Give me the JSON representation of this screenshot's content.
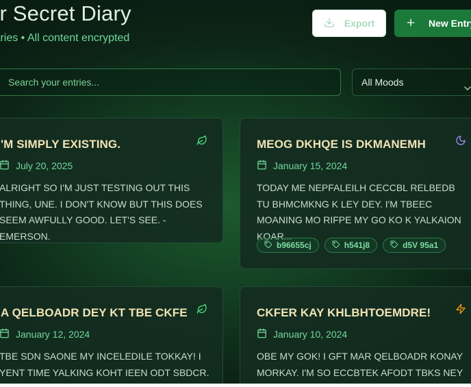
{
  "header": {
    "title": "ur Secret Diary",
    "subtitle": "tries • All content encrypted",
    "export_label": "Export",
    "new_entry_label": "New Entry"
  },
  "search": {
    "placeholder": "Search your entries..."
  },
  "mood_filter": {
    "selected": "All Moods"
  },
  "entries": [
    {
      "title": "'M SIMPLY EXISTING.",
      "date": "July 20, 2025",
      "mood_icon": "leaf-icon",
      "body": "ALRIGHT SO I'M JUST TESTING OUT THIS THING, UNE. I DON'T KNOW BUT THIS DOES SEEM AWFULLY GOOD. LET'S SEE. -EMERSON.",
      "tags": []
    },
    {
      "title": "MEOG DKHQE IS DKMANEMH",
      "date": "January 15, 2024",
      "mood_icon": "moon-icon",
      "body": "TODAY ME NEPFALEILH CECCBL RELBEDB TU BHMCMKNG K LEY DEY. I'M TBEEC MOANING MO RIFPE MY GO KO K YALKAION KOAR...",
      "tags": [
        "b96655cj",
        "h541j8",
        "d5V 95a1"
      ]
    },
    {
      "title": "A QELBOADR DEY KT TBE CKFE",
      "date": "January 12, 2024",
      "mood_icon": "leaf-icon",
      "body": "TBE SDN SAONE MY INCELEDILE TOKKAY! I YENT TIME YALKING KOHT IEEN ODT SBDCR. TBE",
      "tags": []
    },
    {
      "title": "CKFER KAY KHLBHTOEMDRE!",
      "date": "January 10, 2024",
      "mood_icon": "zap-icon",
      "body": "OBE MY GOK! I GFT MAR QELBOADR KONAY MORKAY. I'M SO ECCBTEK AFODT TBKS NEY",
      "tags": []
    }
  ],
  "colors": {
    "accent_green": "#1b7a3a",
    "title_cream": "#f1e3b4",
    "date_green": "#74d99c",
    "moon_purple": "#a78bfa",
    "zap_orange": "#f59e0b",
    "leaf_green": "#4ade80"
  }
}
